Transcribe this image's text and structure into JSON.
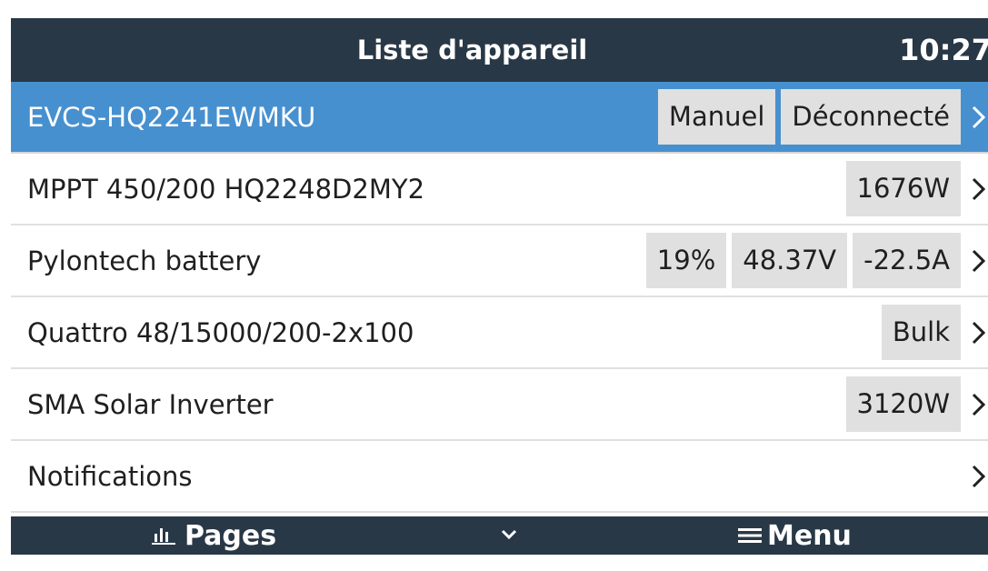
{
  "header": {
    "title": "Liste d'appareil",
    "time": "10:27"
  },
  "devices": [
    {
      "label": "EVCS-HQ2241EWMKU",
      "values": [
        "Manuel",
        "Déconnecté"
      ],
      "selected": true
    },
    {
      "label": "MPPT 450/200 HQ2248D2MY2",
      "values": [
        "1676W"
      ],
      "selected": false
    },
    {
      "label": "Pylontech battery",
      "values": [
        "19%",
        "48.37V",
        "-22.5A"
      ],
      "selected": false
    },
    {
      "label": "Quattro 48/15000/200-2x100",
      "values": [
        "Bulk"
      ],
      "selected": false
    },
    {
      "label": "SMA Solar Inverter",
      "values": [
        "3120W"
      ],
      "selected": false
    },
    {
      "label": "Notifications",
      "values": [],
      "selected": false
    }
  ],
  "footer": {
    "pages_label": "Pages",
    "pages_icon": "bar-chart-icon",
    "center_icon": "chevron-down-icon",
    "menu_label": "Menu",
    "menu_icon": "hamburger-icon"
  },
  "colors": {
    "header_bg": "#283846",
    "selected_row": "#4790d0",
    "value_pill": "#e0e0e0"
  }
}
